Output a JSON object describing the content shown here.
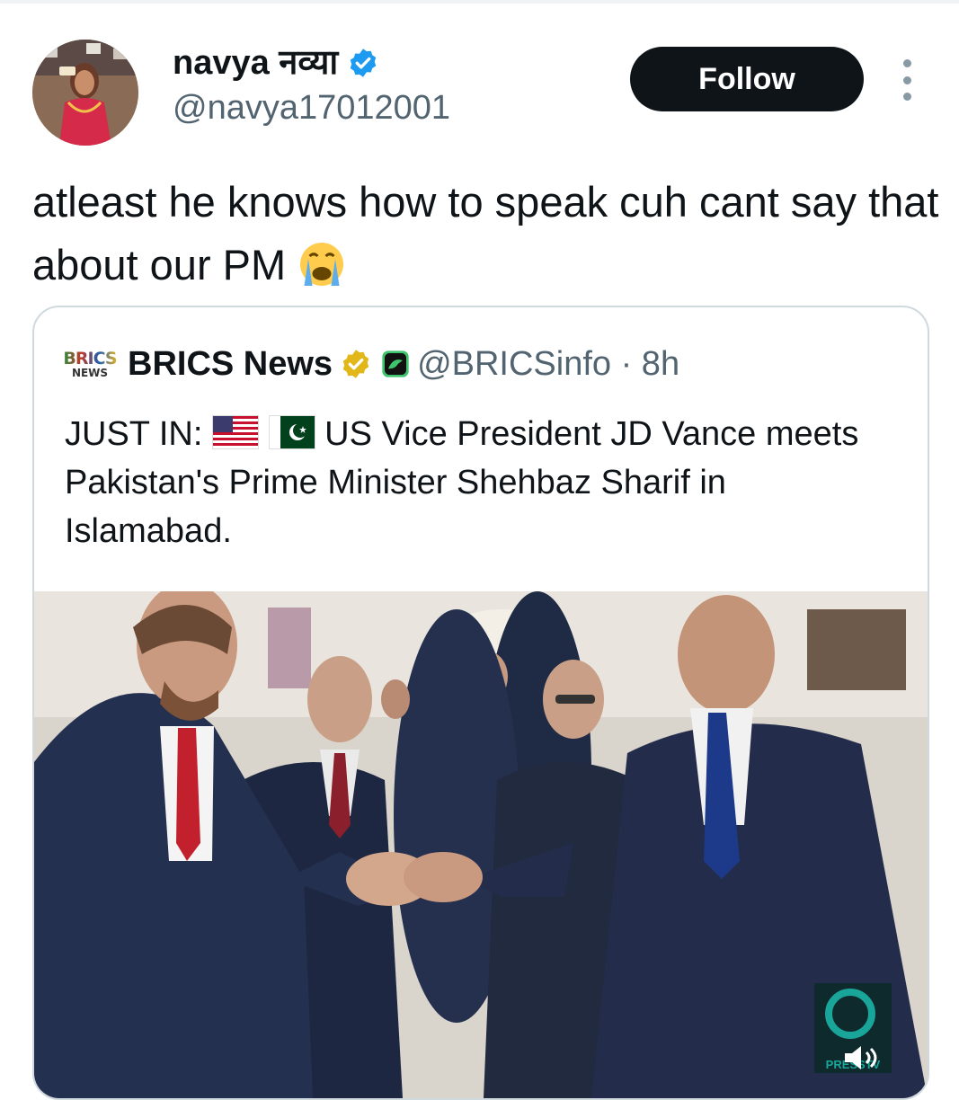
{
  "post": {
    "display_name": "navya नव्या",
    "handle": "@navya17012001",
    "follow_label": "Follow",
    "text": "atleast he knows how to speak cuh cant say that about our PM",
    "emoji": "loudly-crying-face-emoji"
  },
  "quote": {
    "logo_line1": "BRICS",
    "logo_line2": "NEWS",
    "name": "BRICS News",
    "handle_time": "@BRICSinfo · 8h",
    "text_prefix": "JUST IN:",
    "text_body": "US Vice President JD Vance meets Pakistan's Prime Minister Shehbaz Sharif in Islamabad.",
    "media_watermark": "PRESSTV"
  },
  "icons": [
    "verified-badge-icon",
    "gold-verified-badge-icon",
    "affiliate-badge-icon",
    "more-options-icon",
    "us-flag-emoji",
    "pakistan-flag-emoji",
    "sound-icon"
  ],
  "colors": {
    "text": "#0f1419",
    "secondary": "#536471",
    "verified_blue": "#1d9bf0",
    "follow_bg": "#0f1419",
    "border": "#cfd9de"
  }
}
